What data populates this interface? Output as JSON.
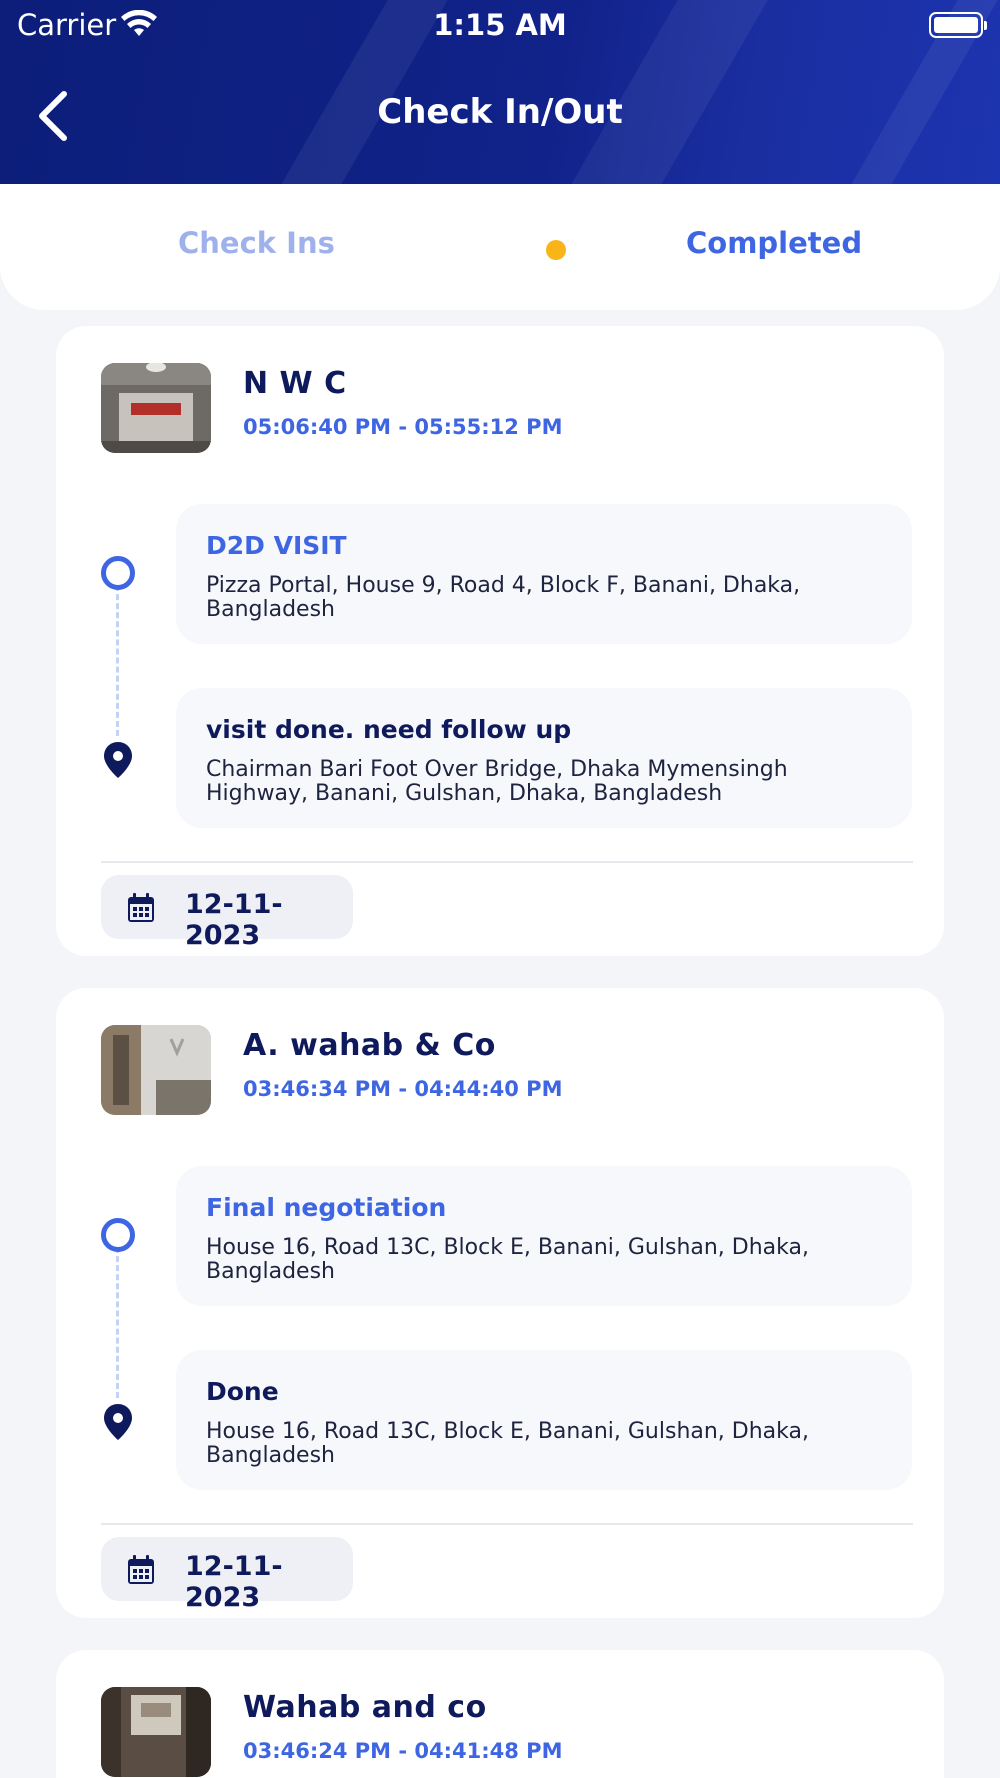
{
  "status_bar": {
    "carrier": "Carrier",
    "time": "1:15 AM"
  },
  "header": {
    "title": "Check In/Out"
  },
  "tabs": {
    "check_ins": "Check Ins",
    "completed": "Completed"
  },
  "colors": {
    "header": "#11228a",
    "accent": "#3e66e2",
    "dot": "#f9b418",
    "navy": "#0f1a5c"
  },
  "cards": [
    {
      "name": "N W C",
      "time_range": "05:06:40 PM - 05:55:12 PM",
      "checkin": {
        "title": "D2D VISIT",
        "address": "Pizza Portal, House 9, Road 4, Block F, Banani, Dhaka, Bangladesh"
      },
      "checkout": {
        "title": "visit done. need follow up",
        "address": "Chairman Bari Foot Over Bridge, Dhaka Mymensingh Highway, Banani, Gulshan, Dhaka, Bangladesh"
      },
      "date": "12-11-2023"
    },
    {
      "name": "A. wahab & Co",
      "time_range": "03:46:34 PM - 04:44:40 PM",
      "checkin": {
        "title": "Final negotiation",
        "address": "House 16, Road 13C, Block E, Banani, Gulshan, Dhaka, Bangladesh"
      },
      "checkout": {
        "title": "Done",
        "address": "House 16, Road 13C, Block E, Banani, Gulshan, Dhaka, Bangladesh"
      },
      "date": "12-11-2023"
    },
    {
      "name": "Wahab and co",
      "time_range": "03:46:24 PM - 04:41:48 PM"
    }
  ]
}
